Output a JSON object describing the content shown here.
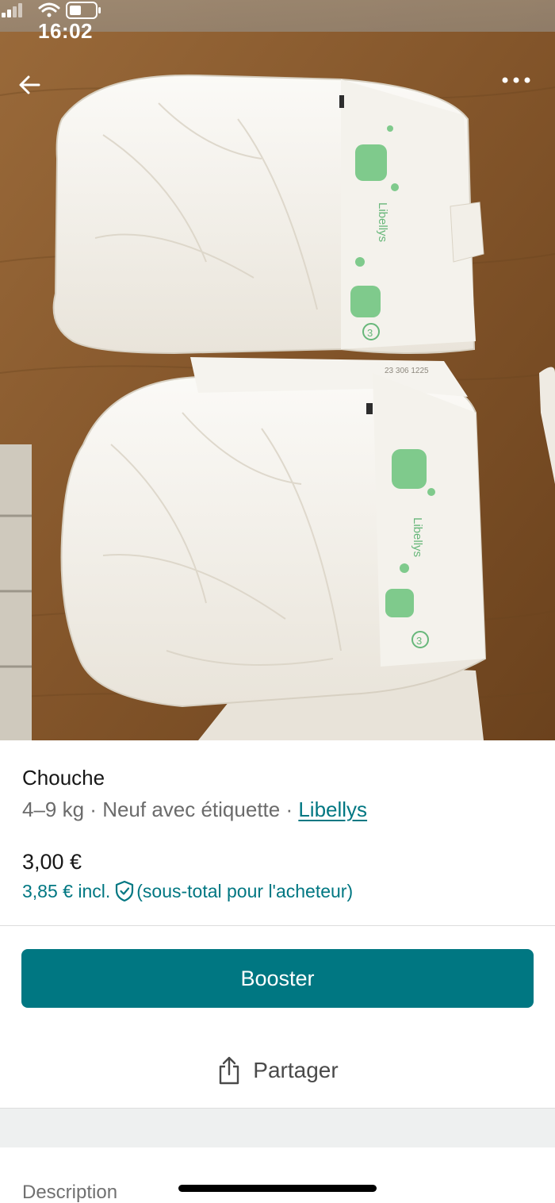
{
  "status_bar": {
    "time": "16:02",
    "signal_icon": "cellular-signal-icon",
    "wifi_icon": "wifi-icon",
    "battery_icon": "battery-icon"
  },
  "toolbar": {
    "back_icon": "arrow-left-icon",
    "more_icon": "more-horizontal-icon"
  },
  "photo": {
    "subject": "two-diapers",
    "printed_brand": "Libellys",
    "printed_size": "3",
    "printed_code": "23 306 1225"
  },
  "item": {
    "title": "Chouche",
    "size": "4–9 kg",
    "separator": " · ",
    "condition": "Neuf avec étiquette",
    "brand": "Libellys",
    "price": "3,00 €",
    "price_incl_amount": "3,85 € incl.",
    "price_incl_note": "(sous-total pour l'acheteur)",
    "shield_icon": "shield-check-icon"
  },
  "actions": {
    "booster_label": "Booster",
    "share_label": "Partager",
    "share_icon": "share-icon"
  },
  "description": {
    "label": "Description"
  },
  "colors": {
    "accent": "#007782",
    "secondary_text": "#6b6b6b",
    "band": "#eef0f0"
  }
}
